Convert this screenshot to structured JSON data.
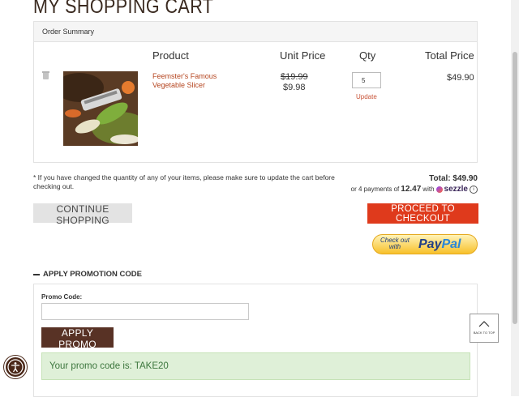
{
  "page": {
    "title": "MY SHOPPING CART"
  },
  "order_summary": {
    "heading": "Order Summary",
    "columns": [
      "Product",
      "Unit Price",
      "Qty",
      "Total Price"
    ],
    "items": [
      {
        "product": "Feemster's Famous Vegetable Slicer",
        "unit_price_original": "$19.99",
        "unit_price": "$9.98",
        "qty": "5",
        "update_label": "Update",
        "total": "$49.90"
      }
    ]
  },
  "note": "* If you have changed the quantity of any of your items, please make sure to update the cart before checking out.",
  "totals": {
    "total_label": "Total:",
    "total_value": "$49.90",
    "sezzle_prefix": "or 4 payments of",
    "sezzle_amount": "12.47",
    "sezzle_with": "with",
    "sezzle_logo": "sezzle",
    "info_glyph": "i"
  },
  "buttons": {
    "continue": "CONTINUE SHOPPING",
    "checkout": "PROCEED TO CHECKOUT",
    "paypal_checkout_line1": "Check out",
    "paypal_checkout_line2": "with",
    "paypal_pay": "Pay",
    "paypal_pal": "Pal"
  },
  "promo": {
    "toggle_label": "APPLY PROMOTION CODE",
    "field_label": "Promo Code:",
    "field_value": "",
    "apply_label": "APPLY PROMO",
    "success_message": "Your promo code is: TAKE20"
  },
  "floating": {
    "back_to_top": "BACK TO TOP"
  },
  "icons": {
    "trash": "trash-icon",
    "minus": "minus-icon",
    "accessibility": "accessibility-icon",
    "chevron_up": "chevron-up-icon",
    "sezzle": "sezzle-logo-icon",
    "info": "info-icon"
  },
  "colors": {
    "checkout": "#df3a1c",
    "apply_promo": "#583225",
    "product_link": "#b5451f",
    "success_bg": "#dff0d8",
    "success_text": "#3c763d"
  }
}
